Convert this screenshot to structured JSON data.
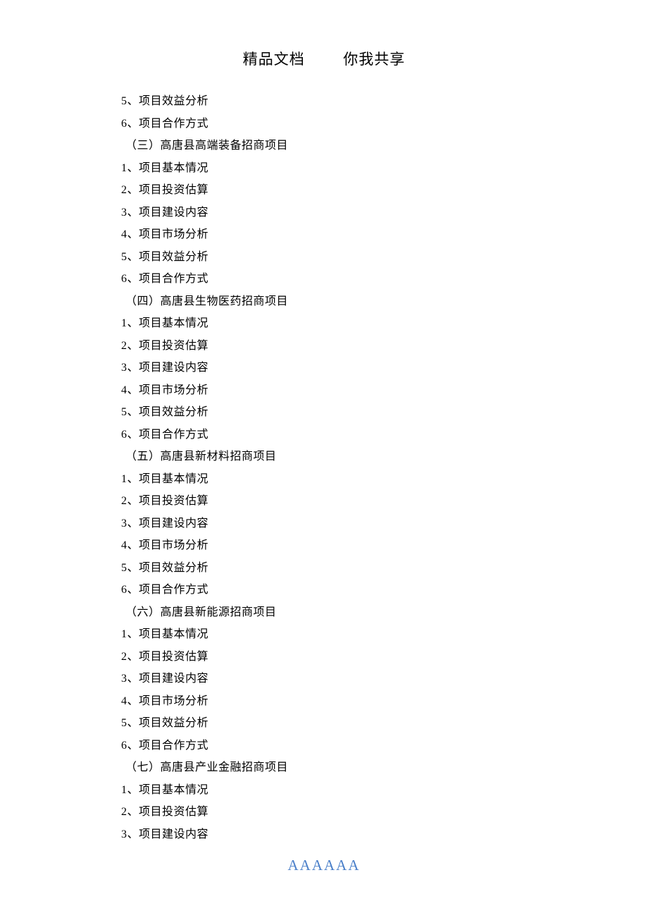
{
  "header": {
    "left": "精品文档",
    "right": "你我共享"
  },
  "preItems": [
    "5、项目效益分析",
    "6、项目合作方式"
  ],
  "sections": [
    {
      "heading": "（三）高唐县高端装备招商项目",
      "items": [
        "1、项目基本情况",
        "2、项目投资估算",
        "3、项目建设内容",
        "4、项目市场分析",
        "5、项目效益分析",
        "6、项目合作方式"
      ]
    },
    {
      "heading": "（四）高唐县生物医药招商项目",
      "items": [
        "1、项目基本情况",
        "2、项目投资估算",
        "3、项目建设内容",
        "4、项目市场分析",
        "5、项目效益分析",
        "6、项目合作方式"
      ]
    },
    {
      "heading": "（五）高唐县新材料招商项目",
      "items": [
        "1、项目基本情况",
        "2、项目投资估算",
        "3、项目建设内容",
        "4、项目市场分析",
        "5、项目效益分析",
        "6、项目合作方式"
      ]
    },
    {
      "heading": "（六）高唐县新能源招商项目",
      "items": [
        "1、项目基本情况",
        "2、项目投资估算",
        "3、项目建设内容",
        "4、项目市场分析",
        "5、项目效益分析",
        "6、项目合作方式"
      ]
    },
    {
      "heading": "（七）高唐县产业金融招商项目",
      "items": [
        "1、项目基本情况",
        "2、项目投资估算",
        "3、项目建设内容"
      ]
    }
  ],
  "footer": "AAAAAA"
}
